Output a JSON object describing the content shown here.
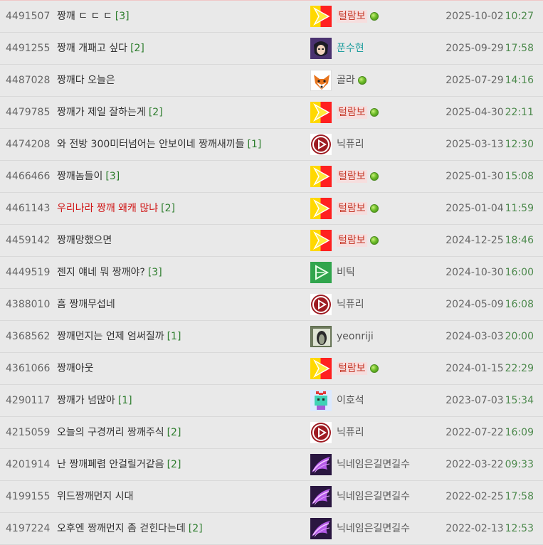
{
  "rows": [
    {
      "num": "4491507",
      "title": "짱깨 ㄷ ㄷ ㄷ",
      "comments": "[3]",
      "red": false,
      "avatar": "yellow-red-logo",
      "nick": "털람보",
      "nick_style": "red",
      "badge": true,
      "date": "2025-10-02",
      "time": "10:27"
    },
    {
      "num": "4491255",
      "title": "짱깨 개패고 싶다",
      "comments": "[2]",
      "red": false,
      "avatar": "anime-portrait",
      "nick": "푼수현",
      "nick_style": "teal",
      "badge": false,
      "date": "2025-09-29",
      "time": "17:58"
    },
    {
      "num": "4487028",
      "title": "짱깨다 오늘은",
      "comments": "",
      "red": false,
      "avatar": "fox-face",
      "nick": "골라",
      "nick_style": "plain",
      "badge": true,
      "date": "2025-07-29",
      "time": "14:16"
    },
    {
      "num": "4479785",
      "title": "짱깨가 제일 잘하는게",
      "comments": "[2]",
      "red": false,
      "avatar": "yellow-red-logo",
      "nick": "털람보",
      "nick_style": "red",
      "badge": true,
      "date": "2025-04-30",
      "time": "22:11"
    },
    {
      "num": "4474208",
      "title": "와 전방 300미터넘어는 안보이네 짱깨새끼들",
      "comments": "[1]",
      "red": false,
      "avatar": "red-play-circle",
      "nick": "닉퓨리",
      "nick_style": "plain",
      "badge": false,
      "date": "2025-03-13",
      "time": "12:30"
    },
    {
      "num": "4466466",
      "title": "짱깨놈들이",
      "comments": "[3]",
      "red": false,
      "avatar": "yellow-red-logo",
      "nick": "털람보",
      "nick_style": "red",
      "badge": true,
      "date": "2025-01-30",
      "time": "15:08"
    },
    {
      "num": "4461143",
      "title": "우리나라 짱깨 왜캐 많냐",
      "comments": "[2]",
      "red": true,
      "avatar": "yellow-red-logo",
      "nick": "털람보",
      "nick_style": "red",
      "badge": true,
      "date": "2025-01-04",
      "time": "11:59"
    },
    {
      "num": "4459142",
      "title": "짱깨망했으면",
      "comments": "",
      "red": false,
      "avatar": "yellow-red-logo",
      "nick": "털람보",
      "nick_style": "red",
      "badge": true,
      "date": "2024-12-25",
      "time": "18:46"
    },
    {
      "num": "4449519",
      "title": "젠지 얘네 뭐 짱깨야?",
      "comments": "[3]",
      "red": false,
      "avatar": "green-play",
      "nick": "비틱",
      "nick_style": "plain",
      "badge": false,
      "date": "2024-10-30",
      "time": "16:00"
    },
    {
      "num": "4388010",
      "title": "흠 짱깨무섭네",
      "comments": "",
      "red": false,
      "avatar": "red-play-circle",
      "nick": "닉퓨리",
      "nick_style": "plain",
      "badge": false,
      "date": "2024-05-09",
      "time": "16:08"
    },
    {
      "num": "4368562",
      "title": "짱깨먼지는 언제 엄써질까",
      "comments": "[1]",
      "red": false,
      "avatar": "photo-frame",
      "nick": "yeonriji",
      "nick_style": "plain",
      "badge": false,
      "date": "2024-03-03",
      "time": "20:00"
    },
    {
      "num": "4361066",
      "title": "짱깨아웃",
      "comments": "",
      "red": false,
      "avatar": "yellow-red-logo",
      "nick": "털람보",
      "nick_style": "red",
      "badge": true,
      "date": "2024-01-15",
      "time": "22:29"
    },
    {
      "num": "4290117",
      "title": "짱깨가 넘많아",
      "comments": "[1]",
      "red": false,
      "avatar": "pixel-character",
      "nick": "이호석",
      "nick_style": "plain",
      "badge": false,
      "date": "2023-07-03",
      "time": "15:34"
    },
    {
      "num": "4215059",
      "title": "오늘의 구경꺼리 짱깨주식",
      "comments": "[2]",
      "red": false,
      "avatar": "red-play-circle",
      "nick": "닉퓨리",
      "nick_style": "plain",
      "badge": false,
      "date": "2022-07-22",
      "time": "16:09"
    },
    {
      "num": "4201914",
      "title": "난 짱깨폐렴 안걸릴거같음",
      "comments": "[2]",
      "red": false,
      "avatar": "purple-wing",
      "nick": "닉네임은길면길수",
      "nick_style": "plain",
      "badge": false,
      "date": "2022-03-22",
      "time": "09:33"
    },
    {
      "num": "4199155",
      "title": "위드짱깨먼지 시대",
      "comments": "",
      "red": false,
      "avatar": "purple-wing",
      "nick": "닉네임은길면길수",
      "nick_style": "plain",
      "badge": false,
      "date": "2022-02-25",
      "time": "17:58"
    },
    {
      "num": "4197224",
      "title": "오후엔 짱깨먼지 좀 걷힌다는데",
      "comments": "[2]",
      "red": false,
      "avatar": "purple-wing",
      "nick": "닉네임은길면길수",
      "nick_style": "plain",
      "badge": false,
      "date": "2022-02-13",
      "time": "12:53"
    }
  ]
}
